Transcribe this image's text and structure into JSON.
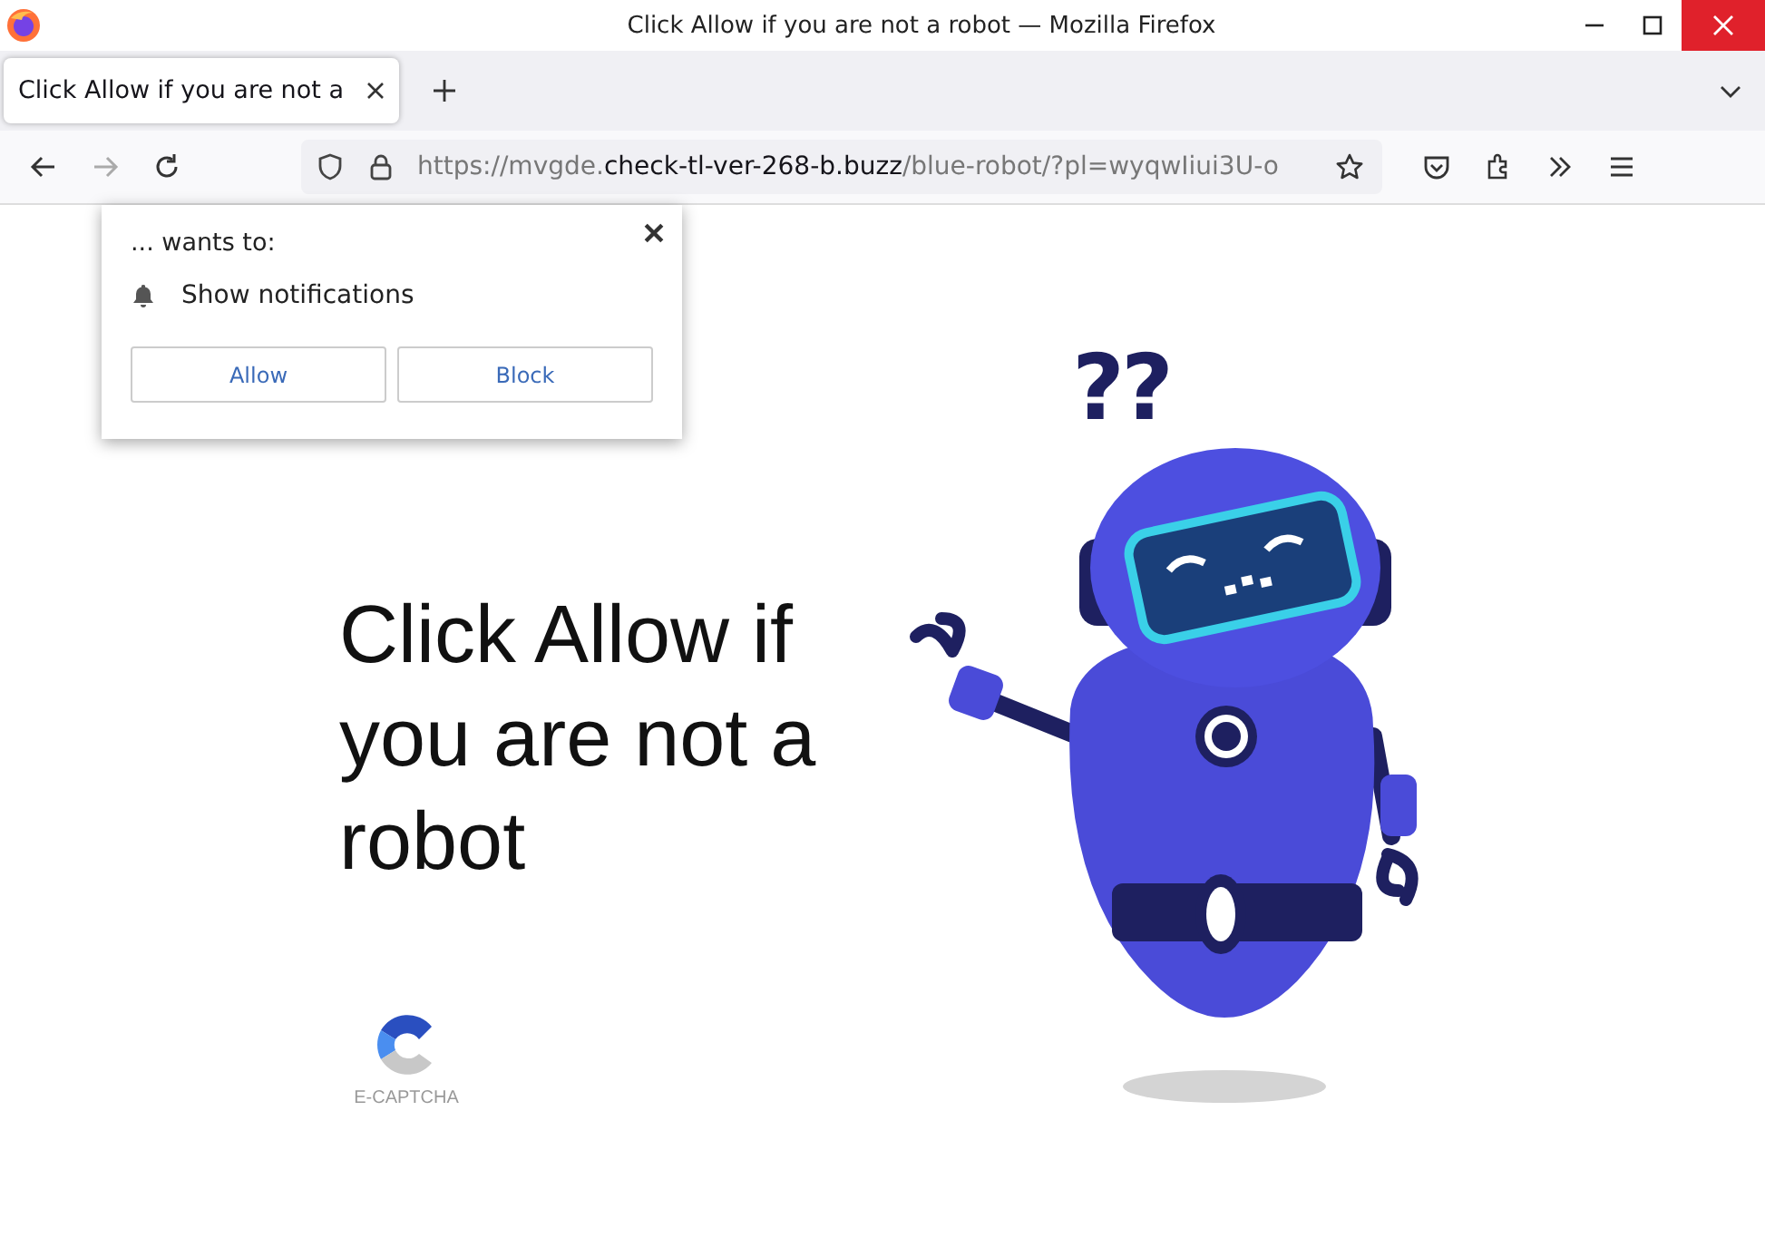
{
  "window": {
    "title": "Click Allow if you are not a robot — Mozilla Firefox"
  },
  "tabs": [
    {
      "label": "Click Allow if you are not a",
      "selected": true
    }
  ],
  "address_bar": {
    "url_parts": [
      {
        "text": "https://mvgde.",
        "emphasis": false
      },
      {
        "text": "check-tl-ver-268-b.buzz",
        "emphasis": true
      },
      {
        "text": "/blue-robot/?pl=wyqwIiui3U-o",
        "emphasis": false
      }
    ]
  },
  "permission_popup": {
    "prompt": "... wants to:",
    "permission": "Show notifications",
    "buttons": [
      "Allow",
      "Block"
    ]
  },
  "page": {
    "heading": "Click Allow if you are not a robot",
    "robot_thought": "??",
    "captcha_label": "E-CAPTCHA"
  }
}
